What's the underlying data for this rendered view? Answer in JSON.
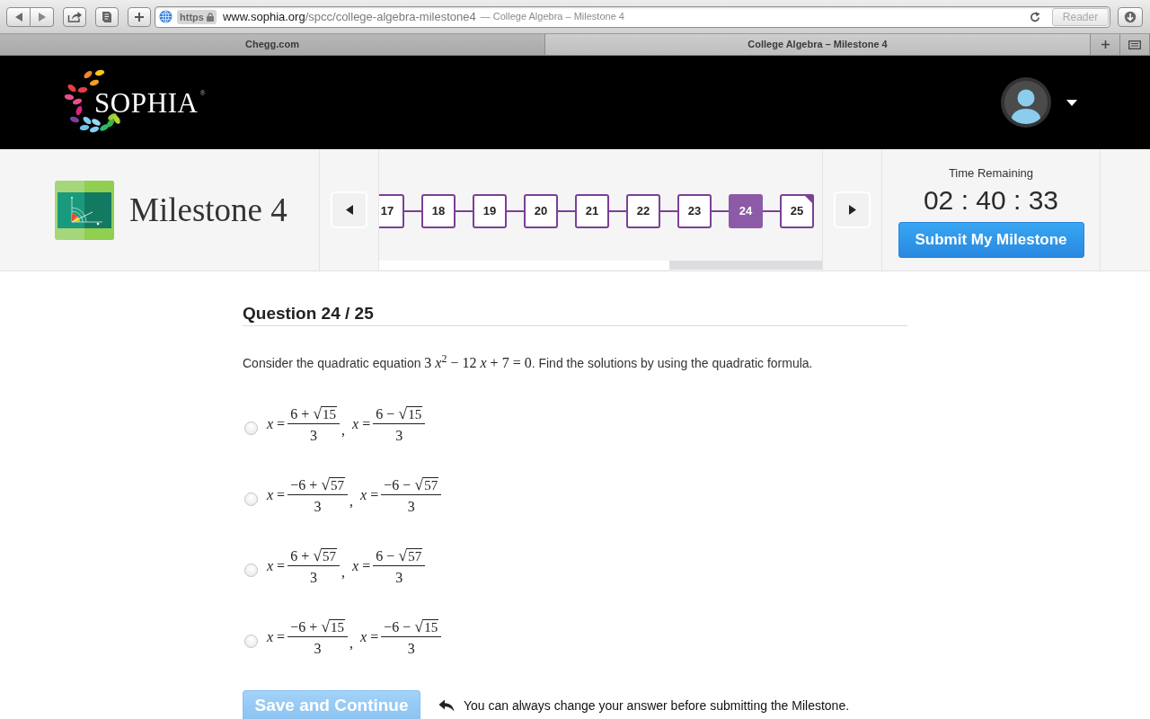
{
  "browser": {
    "address": {
      "scheme": "https",
      "host": "www.sophia.org",
      "path": "/spcc/college-algebra-milestone4",
      "page_title": "— College Algebra – Milestone 4"
    },
    "reader": {
      "label": "Reader",
      "disabled": true
    },
    "tabs": [
      {
        "label": "Chegg.com",
        "selected": false
      },
      {
        "label": "College Algebra – Milestone 4",
        "selected": true
      }
    ]
  },
  "header": {
    "logo": {
      "name": "SOPHIA",
      "mark": "®"
    }
  },
  "milestone": {
    "title": "Milestone 4",
    "steps": [
      {
        "label": "17",
        "selected": false,
        "flagged": false
      },
      {
        "label": "18",
        "selected": false,
        "flagged": false
      },
      {
        "label": "19",
        "selected": false,
        "flagged": false
      },
      {
        "label": "20",
        "selected": false,
        "flagged": false
      },
      {
        "label": "21",
        "selected": false,
        "flagged": false
      },
      {
        "label": "22",
        "selected": false,
        "flagged": false
      },
      {
        "label": "23",
        "selected": false,
        "flagged": false
      },
      {
        "label": "24",
        "selected": true,
        "flagged": false
      },
      {
        "label": "25",
        "selected": false,
        "flagged": true
      }
    ],
    "timer": {
      "label": "Time Remaining",
      "value": "02 : 40 : 33"
    },
    "submit_button": "Submit My Milestone"
  },
  "question": {
    "heading": "Question 24 / 25",
    "prompt_start": "Consider the quadratic equation",
    "equation": "3 *x*$^{2}$ − 12 *x* + 7 = 0",
    "prompt_end": ". Find the solutions by using the quadratic formula.",
    "choices": [
      {
        "selected": false,
        "separator": ",",
        "roots": [
          {
            "lhs": "*x* =",
            "before": "6 + ",
            "radical": "√",
            "radicand": "15",
            "denominator": "3"
          },
          {
            "lhs": "*x* =",
            "before": "6 − ",
            "radical": "√",
            "radicand": "15",
            "denominator": "3"
          }
        ]
      },
      {
        "selected": false,
        "separator": ",",
        "roots": [
          {
            "lhs": "*x* =",
            "before": "−6 + ",
            "radical": "√",
            "radicand": "57",
            "denominator": "3"
          },
          {
            "lhs": "*x* =",
            "before": "−6 − ",
            "radical": "√",
            "radicand": "57",
            "denominator": "3"
          }
        ]
      },
      {
        "selected": false,
        "separator": ",",
        "roots": [
          {
            "lhs": "*x* =",
            "before": "6 + ",
            "radical": "√",
            "radicand": "57",
            "denominator": "3"
          },
          {
            "lhs": "*x* =",
            "before": "6 − ",
            "radical": "√",
            "radicand": "57",
            "denominator": "3"
          }
        ]
      },
      {
        "selected": false,
        "separator": ",",
        "roots": [
          {
            "lhs": "*x* =",
            "before": "−6 + ",
            "radical": "√",
            "radicand": "15",
            "denominator": "3"
          },
          {
            "lhs": "*x* =",
            "before": "−6 − ",
            "radical": "√",
            "radicand": "15",
            "denominator": "3"
          }
        ]
      }
    ]
  },
  "footer": {
    "save_button": {
      "label": "Save and Continue",
      "disabled": true
    },
    "hint": "You can always change your answer before submitting the Milestone."
  }
}
